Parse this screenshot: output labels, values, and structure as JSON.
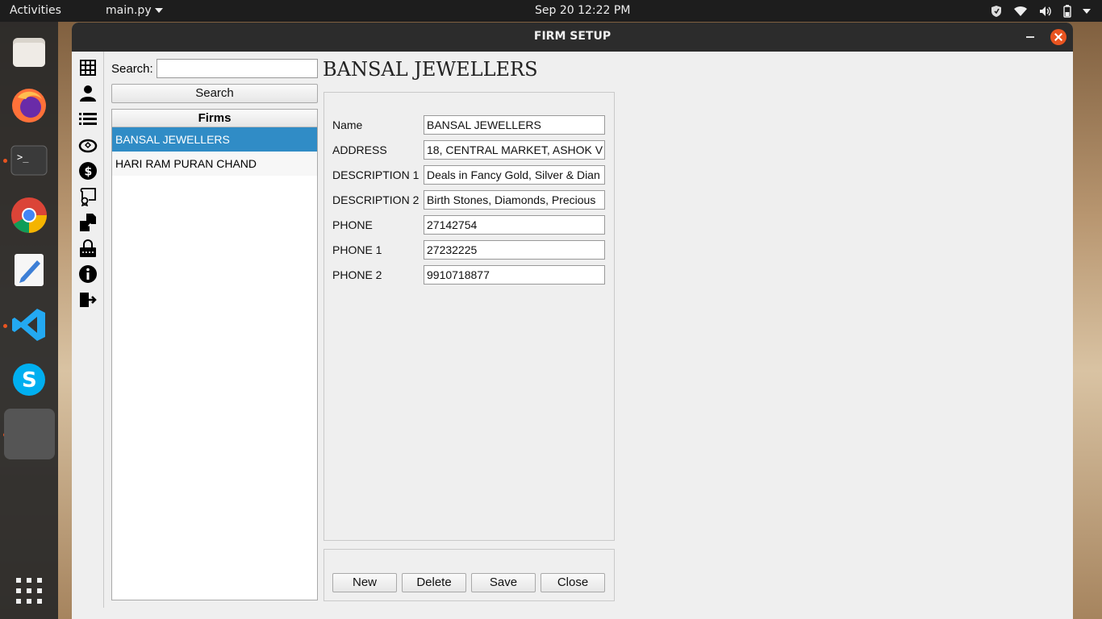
{
  "topbar": {
    "activities": "Activities",
    "app_menu": "main.py",
    "clock": "Sep 20  12:22 PM",
    "tray_icons": [
      "shield-icon",
      "wifi-icon",
      "volume-icon",
      "battery-icon",
      "chevron-down-icon"
    ]
  },
  "dock": {
    "items": [
      "files-icon",
      "firefox-icon",
      "terminal-icon",
      "chrome-icon",
      "text-editor-icon",
      "vscode-icon",
      "skype-icon",
      "python-app-icon",
      "show-apps-icon"
    ]
  },
  "window": {
    "title": "FIRM SETUP"
  },
  "toolbar": {
    "icons": [
      "grid-icon",
      "user-icon",
      "list-icon",
      "ring-icon",
      "dollar-icon",
      "certificate-icon",
      "documents-icon",
      "lock-icon",
      "info-icon",
      "exit-icon"
    ]
  },
  "search": {
    "label": "Search:",
    "value": "",
    "button": "Search"
  },
  "firms": {
    "header": "Firms",
    "items": [
      "BANSAL JEWELLERS",
      "HARI RAM PURAN CHAND"
    ],
    "selected": "BANSAL JEWELLERS"
  },
  "detail": {
    "title": "BANSAL JEWELLERS",
    "fields": [
      {
        "label": "Name",
        "value": "BANSAL JEWELLERS"
      },
      {
        "label": "ADDRESS",
        "value": "18, CENTRAL MARKET, ASHOK V"
      },
      {
        "label": "DESCRIPTION 1",
        "value": "Deals in Fancy Gold, Silver & Dian"
      },
      {
        "label": "DESCRIPTION 2",
        "value": "Birth Stones, Diamonds, Precious"
      },
      {
        "label": "PHONE",
        "value": "27142754"
      },
      {
        "label": "PHONE 1",
        "value": "27232225"
      },
      {
        "label": "PHONE 2",
        "value": "9910718877"
      }
    ]
  },
  "actions": {
    "new": "New",
    "delete": "Delete",
    "save": "Save",
    "close": "Close"
  },
  "colors": {
    "selection": "#308cc6",
    "close_button": "#e95420",
    "titlebar": "#2c2c2c"
  }
}
